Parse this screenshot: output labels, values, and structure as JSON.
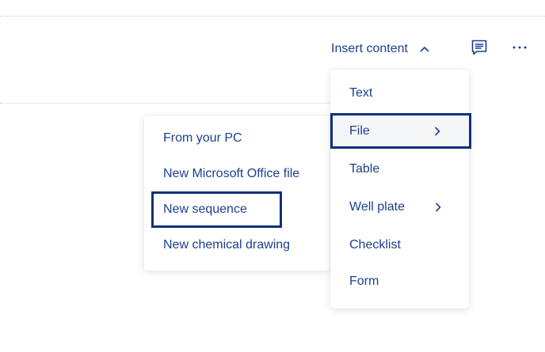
{
  "toolbar": {
    "insert_content_label": "Insert content",
    "icons": [
      "chevron-up-icon",
      "comment-icon",
      "more-options-icon"
    ]
  },
  "insert_menu": {
    "items": [
      {
        "label": "Text"
      },
      {
        "label": "File",
        "has_submenu": true,
        "highlighted": true
      },
      {
        "label": "Table"
      },
      {
        "label": "Well plate",
        "has_submenu": true
      },
      {
        "label": "Checklist"
      },
      {
        "label": "Form"
      }
    ]
  },
  "file_submenu": {
    "items": [
      {
        "label": "From your PC"
      },
      {
        "label": "New Microsoft Office file"
      },
      {
        "label": "New sequence",
        "highlighted": true
      },
      {
        "label": "New chemical drawing"
      }
    ]
  },
  "colors": {
    "text": "#1d3f8f",
    "highlight_border": "#0f2f7a",
    "hover_background": "#f5f6f8",
    "background": "#ffffff"
  }
}
